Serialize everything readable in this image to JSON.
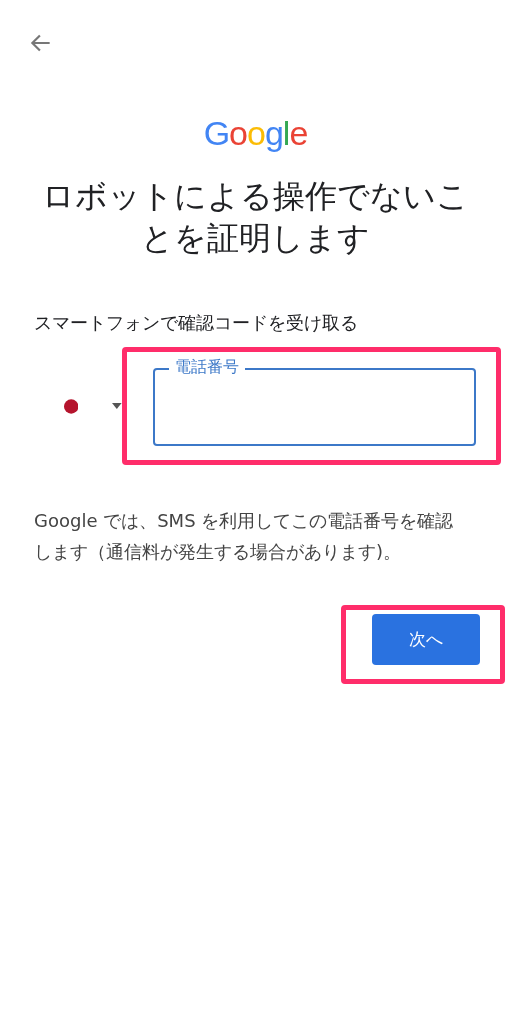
{
  "logo": "Google",
  "title": "ロボットによる操作でないことを証明します",
  "subtitle": "スマートフォンで確認コードを受け取る",
  "phone_field": {
    "label": "電話番号",
    "highlighted": true
  },
  "info": "Google では、SMS を利用してこの電話番号を確認します（通信料が発生する場合があります)。",
  "next_button": {
    "label": "次へ",
    "highlighted": true
  }
}
